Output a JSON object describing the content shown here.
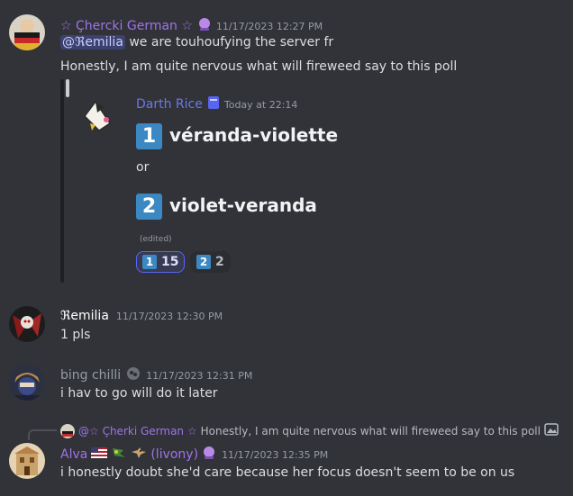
{
  "messages": [
    {
      "username": "☆ Çhercki German ☆",
      "timestamp": "11/17/2023 12:27 PM",
      "mention": "@ℜemilia",
      "line1_rest": " we are touhoufying the server fr",
      "line2": "Honestly, I am quite nervous what will fireweed say to this poll"
    },
    {
      "username": "ℜemilia",
      "timestamp": "11/17/2023 12:30 PM",
      "text": "1 pls"
    },
    {
      "username": "bing chilli",
      "timestamp": "11/17/2023 12:31 PM",
      "text": "i hav to go will do it later"
    },
    {
      "reply_username": "@☆ Çherki German ☆",
      "reply_text": "Honestly, I am quite nervous what will fireweed say to this poll",
      "username": "Alva",
      "username_suffix": "(livony)",
      "timestamp": "11/17/2023 12:35 PM",
      "text": "i honestly doubt she'd care because her focus doesn't seem to be on us"
    }
  ],
  "embed": {
    "author": "Darth Rice",
    "timestamp": "Today at 22:14",
    "option1_num": "1",
    "option1": "véranda-violette",
    "or": "or",
    "option2_num": "2",
    "option2": "violet-veranda",
    "edited": "(edited)",
    "reactions": [
      {
        "emoji": "1",
        "count": "15",
        "selected": true
      },
      {
        "emoji": "2",
        "count": "2",
        "selected": false
      }
    ]
  },
  "colors": {
    "background": "#313338",
    "german_name": "#a073e8",
    "remilia_name": "#ffffff",
    "bing_name": "#949ba4",
    "alva_name": "#a073e8",
    "darth_name": "#6c78e6",
    "number_box": "#3b88c3"
  }
}
